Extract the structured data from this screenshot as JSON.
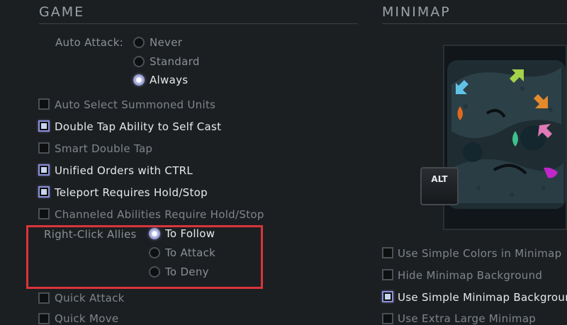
{
  "game": {
    "title": "GAME",
    "auto_attack": {
      "label": "Auto Attack:",
      "options": [
        {
          "label": "Never",
          "selected": false
        },
        {
          "label": "Standard",
          "selected": false
        },
        {
          "label": "Always",
          "selected": true
        }
      ]
    },
    "checkboxes": [
      {
        "label": "Auto Select Summoned Units",
        "checked": false
      },
      {
        "label": "Double Tap Ability to Self Cast",
        "checked": true
      },
      {
        "label": "Smart Double Tap",
        "checked": false
      },
      {
        "label": "Unified Orders with CTRL",
        "checked": true
      },
      {
        "label": "Teleport Requires Hold/Stop",
        "checked": true
      },
      {
        "label": "Channeled Abilities Require Hold/Stop",
        "checked": false
      }
    ],
    "right_click_allies": {
      "label": "Right-Click Allies",
      "options": [
        {
          "label": "To Follow",
          "selected": true
        },
        {
          "label": "To Attack",
          "selected": false
        },
        {
          "label": "To Deny",
          "selected": false
        }
      ]
    },
    "more_checkboxes": [
      {
        "label": "Quick Attack",
        "checked": false
      },
      {
        "label": "Quick Move",
        "checked": false
      }
    ]
  },
  "minimap": {
    "title": "MINIMAP",
    "alt_key": "ALT",
    "checkboxes": [
      {
        "label": "Use Simple Colors in Minimap",
        "checked": false
      },
      {
        "label": "Hide Minimap Background",
        "checked": false
      },
      {
        "label": "Use Simple Minimap Background",
        "checked": true
      },
      {
        "label": "Use Extra Large Minimap",
        "checked": false
      }
    ]
  },
  "colors": {
    "accent_highlight": "#d9343a",
    "checked_border": "#8a8fd6",
    "background": "#1c1f22"
  }
}
